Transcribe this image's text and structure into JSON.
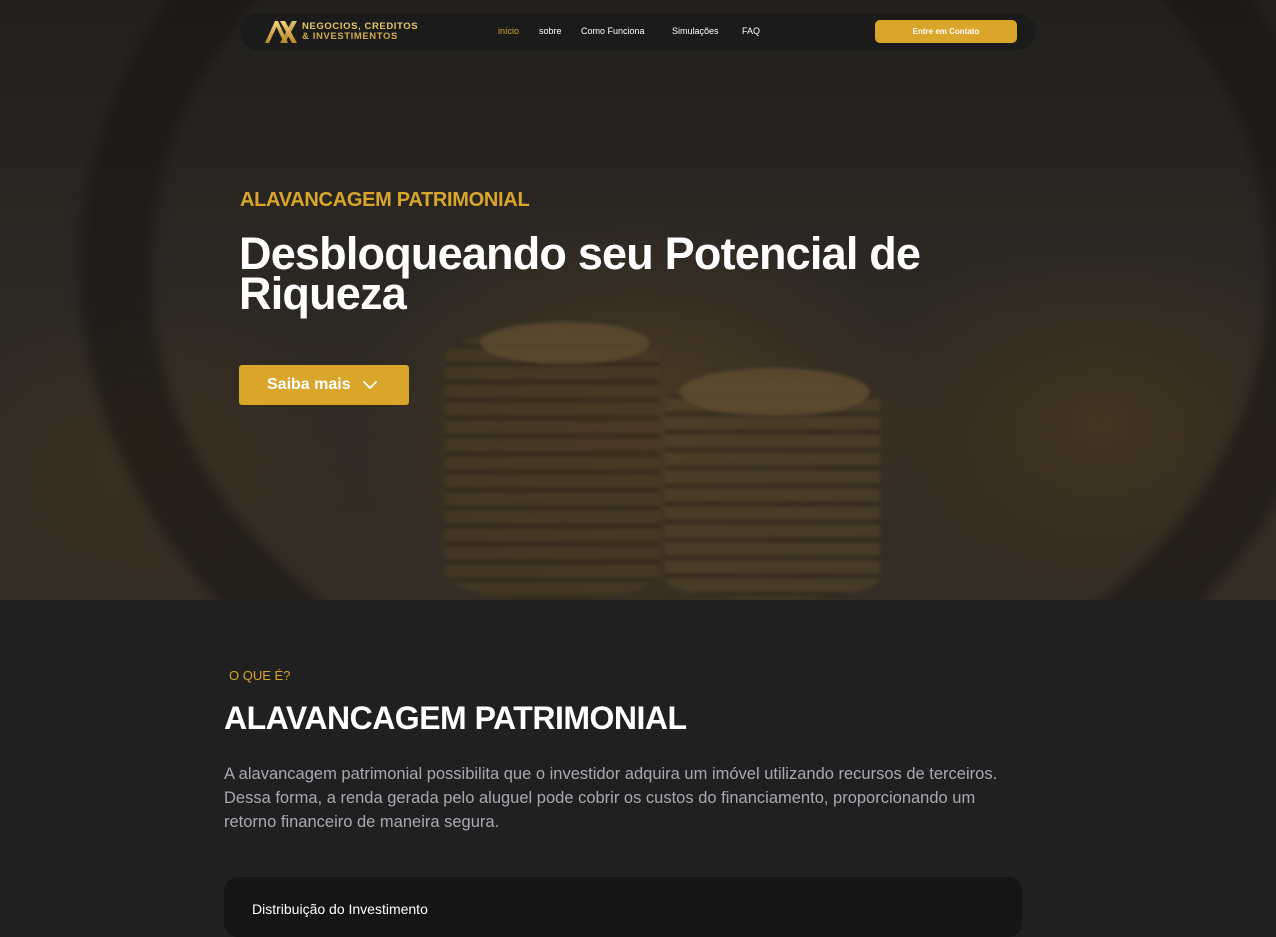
{
  "brand": {
    "logo_mark": "AX",
    "logo_line1": "NEGÓCIOS, CRÉDITOS",
    "logo_line2": "& INVESTIMENTOS"
  },
  "nav": {
    "links": [
      {
        "label": "início",
        "active": true
      },
      {
        "label": "sobre",
        "active": false
      },
      {
        "label": "Como Funciona",
        "active": false
      },
      {
        "label": "Simulações",
        "active": false
      },
      {
        "label": "FAQ",
        "active": false
      }
    ],
    "cta_label": "Entre em Contato"
  },
  "hero": {
    "eyebrow": "ALAVANCAGEM PATRIMONIAL",
    "title": "Desbloqueando seu Potencial de Riqueza",
    "button_label": "Saiba mais",
    "button_icon": "chevron-down-icon"
  },
  "section": {
    "eyebrow": "O QUE É?",
    "title": "ALAVANCAGEM PATRIMONIAL",
    "body": "A alavancagem patrimonial possibilita que o investidor adquira um imóvel utilizando recursos de terceiros. Dessa forma, a renda gerada pelo aluguel pode cobrir os custos do financiamento, proporcionando um retorno financeiro de maneira segura.",
    "card_title": "Distribuição do Investimento"
  },
  "colors": {
    "accent": "#d9a52a",
    "background": "#202020",
    "nav_background": "#1b1b1b",
    "body_text": "#a8a8b2",
    "card_background": "#151515"
  }
}
